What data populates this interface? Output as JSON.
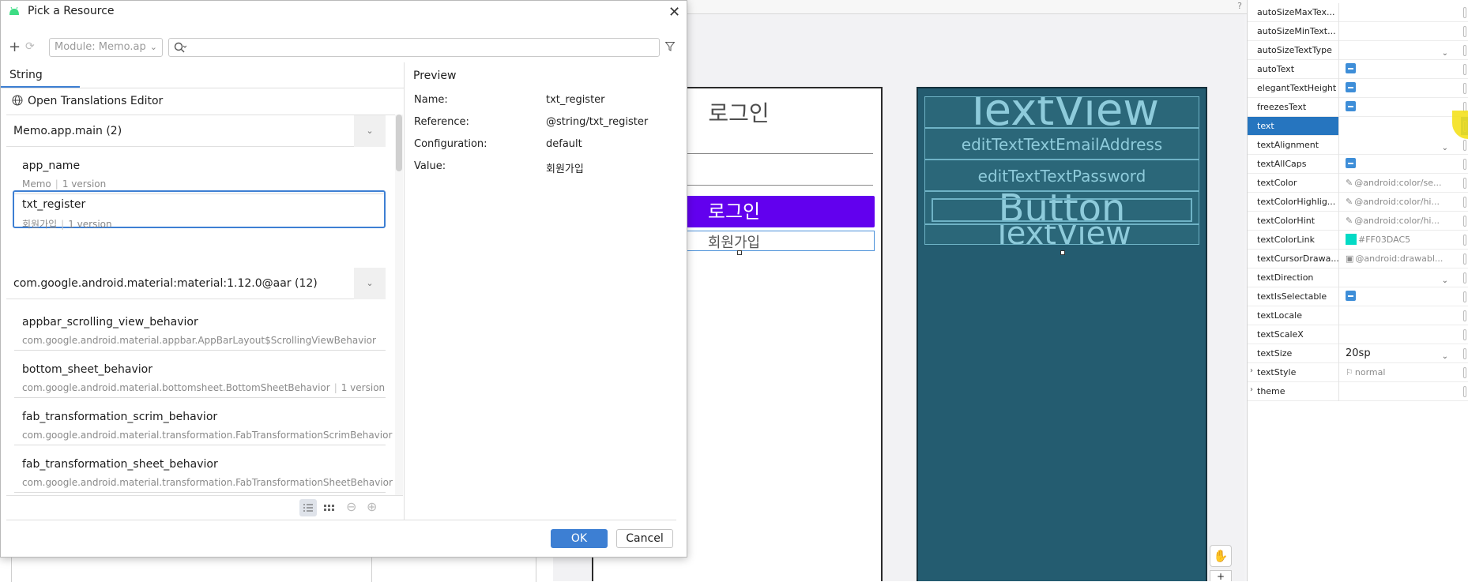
{
  "dialog": {
    "title": "Pick a Resource",
    "module_select": "Module: Memo.ap",
    "search_placeholder": "",
    "tab": "String",
    "open_translations": "Open Translations Editor",
    "groups": [
      {
        "header": "Memo.app.main (2)",
        "items": [
          {
            "name": "app_name",
            "value": "Memo",
            "versions": "1 version"
          },
          {
            "name": "txt_register",
            "value": "회원가입",
            "versions": "1 version"
          }
        ]
      },
      {
        "header": "com.google.android.material:material:1.12.0@aar (12)",
        "items": [
          {
            "name": "appbar_scrolling_view_behavior",
            "value": "com.google.android.material.appbar.AppBarLayout$ScrollingViewBehavior"
          },
          {
            "name": "bottom_sheet_behavior",
            "value": "com.google.android.material.bottomsheet.BottomSheetBehavior",
            "versions": "1 version"
          },
          {
            "name": "fab_transformation_scrim_behavior",
            "value": "com.google.android.material.transformation.FabTransformationScrimBehavior"
          },
          {
            "name": "fab_transformation_sheet_behavior",
            "value": "com.google.android.material.transformation.FabTransformationSheetBehavior"
          }
        ]
      }
    ],
    "preview": {
      "title": "Preview",
      "rows": [
        {
          "label": "Name:",
          "value": "txt_register"
        },
        {
          "label": "Reference:",
          "value": "@string/txt_register"
        },
        {
          "label": "Configuration:",
          "value": "default"
        },
        {
          "label": "Value:",
          "value": "회원가입"
        }
      ]
    },
    "ok_label": "OK",
    "cancel_label": "Cancel"
  },
  "design": {
    "title": "로그인",
    "button": "로그인",
    "register": "회원가입",
    "accent": "#6200EE"
  },
  "blueprint": {
    "textview_top": "TextView",
    "email": "editTextTextEmailAddress",
    "password": "editTextTextPassword",
    "button": "Button",
    "textview_bottom": "TextView"
  },
  "attributes": [
    {
      "name": "autoSizeMaxTex...",
      "kind": "empty"
    },
    {
      "name": "autoSizeMinText...",
      "kind": "empty"
    },
    {
      "name": "autoSizeTextType",
      "kind": "dropdown"
    },
    {
      "name": "autoText",
      "kind": "check"
    },
    {
      "name": "elegantTextHeight",
      "kind": "check"
    },
    {
      "name": "freezesText",
      "kind": "check"
    },
    {
      "name": "text",
      "kind": "selected"
    },
    {
      "name": "textAlignment",
      "kind": "dropdown"
    },
    {
      "name": "textAllCaps",
      "kind": "check"
    },
    {
      "name": "textColor",
      "kind": "color",
      "value": "@android:color/se..."
    },
    {
      "name": "textColorHighlig...",
      "kind": "color",
      "value": "@android:color/hi..."
    },
    {
      "name": "textColorHint",
      "kind": "color",
      "value": "@android:color/hi..."
    },
    {
      "name": "textColorLink",
      "kind": "swatch",
      "value": "#FF03DAC5"
    },
    {
      "name": "textCursorDrawa...",
      "kind": "image",
      "value": "@android:drawabl..."
    },
    {
      "name": "textDirection",
      "kind": "dropdown"
    },
    {
      "name": "textIsSelectable",
      "kind": "check"
    },
    {
      "name": "textLocale",
      "kind": "empty"
    },
    {
      "name": "textScaleX",
      "kind": "empty"
    },
    {
      "name": "textSize",
      "kind": "dropdown-value",
      "value": "20sp"
    },
    {
      "name": "textStyle",
      "kind": "flag",
      "value": "normal",
      "expand": true
    },
    {
      "name": "theme",
      "kind": "empty",
      "expand": true
    }
  ]
}
